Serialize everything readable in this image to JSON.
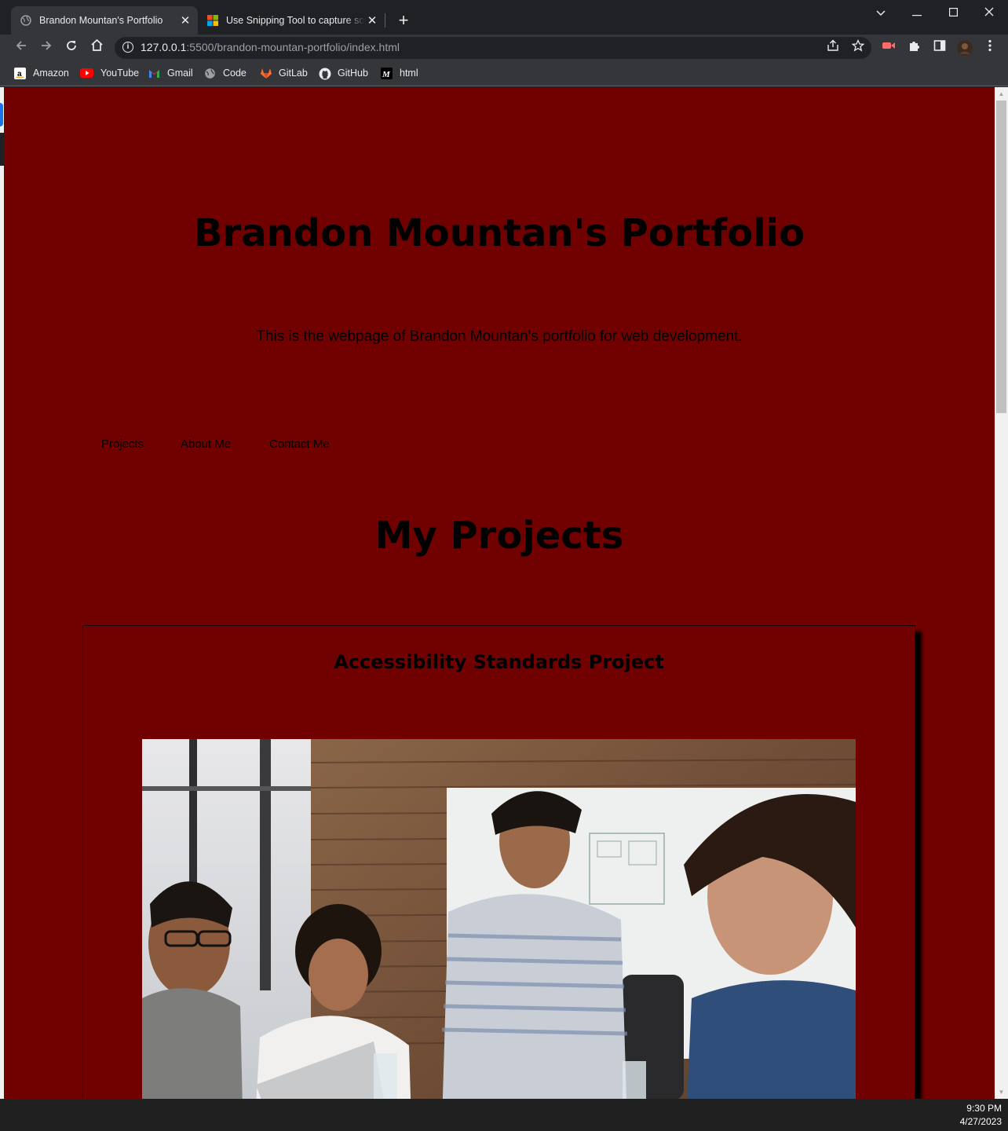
{
  "browser": {
    "tabs": [
      {
        "title": "Brandon Mountan's Portfolio",
        "active": true,
        "icon": "globe-icon"
      },
      {
        "title": "Use Snipping Tool to capture scr",
        "active": false,
        "icon": "microsoft-logo-icon"
      }
    ],
    "url_host": "127.0.0.1",
    "url_rest": ":5500/brandon-mountan-portfolio/index.html",
    "bookmarks": [
      {
        "label": "Amazon",
        "icon": "amazon-icon"
      },
      {
        "label": "YouTube",
        "icon": "youtube-icon"
      },
      {
        "label": "Gmail",
        "icon": "gmail-icon"
      },
      {
        "label": "Code",
        "icon": "globe-icon"
      },
      {
        "label": "GitLab",
        "icon": "gitlab-icon"
      },
      {
        "label": "GitHub",
        "icon": "github-icon"
      },
      {
        "label": "html",
        "icon": "medium-icon"
      }
    ]
  },
  "page": {
    "background_color": "#710000",
    "title": "Brandon Mountan's Portfolio",
    "tagline": "This is the webpage of Brandon Mountan's portfolio for web development.",
    "nav": [
      "Projects",
      "About Me",
      "Contact Me"
    ],
    "projects_heading": "My Projects",
    "projects": [
      {
        "title": "Accessibility Standards Project",
        "image": "team-meeting-photo"
      }
    ]
  },
  "taskbar": {
    "time": "9:30 PM",
    "date": "4/27/2023"
  }
}
